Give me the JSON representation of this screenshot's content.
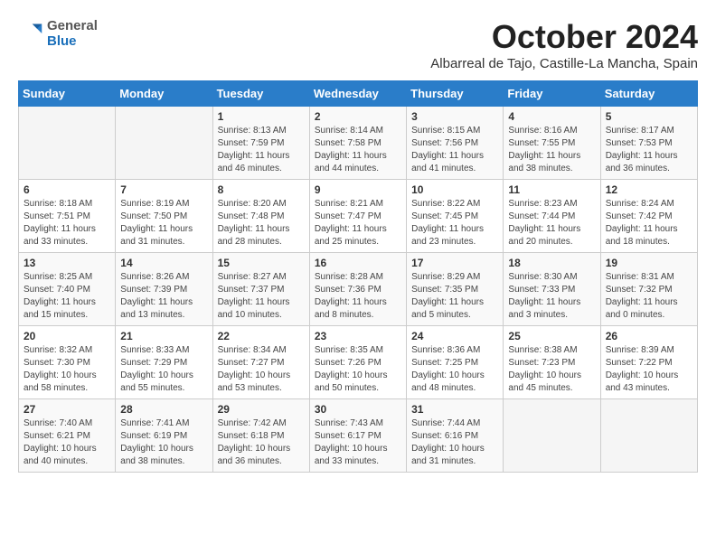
{
  "header": {
    "logo_general": "General",
    "logo_blue": "Blue",
    "month_title": "October 2024",
    "subtitle": "Albarreal de Tajo, Castille-La Mancha, Spain"
  },
  "weekdays": [
    "Sunday",
    "Monday",
    "Tuesday",
    "Wednesday",
    "Thursday",
    "Friday",
    "Saturday"
  ],
  "weeks": [
    [
      {
        "day": "",
        "info": ""
      },
      {
        "day": "",
        "info": ""
      },
      {
        "day": "1",
        "info": "Sunrise: 8:13 AM\nSunset: 7:59 PM\nDaylight: 11 hours and 46 minutes."
      },
      {
        "day": "2",
        "info": "Sunrise: 8:14 AM\nSunset: 7:58 PM\nDaylight: 11 hours and 44 minutes."
      },
      {
        "day": "3",
        "info": "Sunrise: 8:15 AM\nSunset: 7:56 PM\nDaylight: 11 hours and 41 minutes."
      },
      {
        "day": "4",
        "info": "Sunrise: 8:16 AM\nSunset: 7:55 PM\nDaylight: 11 hours and 38 minutes."
      },
      {
        "day": "5",
        "info": "Sunrise: 8:17 AM\nSunset: 7:53 PM\nDaylight: 11 hours and 36 minutes."
      }
    ],
    [
      {
        "day": "6",
        "info": "Sunrise: 8:18 AM\nSunset: 7:51 PM\nDaylight: 11 hours and 33 minutes."
      },
      {
        "day": "7",
        "info": "Sunrise: 8:19 AM\nSunset: 7:50 PM\nDaylight: 11 hours and 31 minutes."
      },
      {
        "day": "8",
        "info": "Sunrise: 8:20 AM\nSunset: 7:48 PM\nDaylight: 11 hours and 28 minutes."
      },
      {
        "day": "9",
        "info": "Sunrise: 8:21 AM\nSunset: 7:47 PM\nDaylight: 11 hours and 25 minutes."
      },
      {
        "day": "10",
        "info": "Sunrise: 8:22 AM\nSunset: 7:45 PM\nDaylight: 11 hours and 23 minutes."
      },
      {
        "day": "11",
        "info": "Sunrise: 8:23 AM\nSunset: 7:44 PM\nDaylight: 11 hours and 20 minutes."
      },
      {
        "day": "12",
        "info": "Sunrise: 8:24 AM\nSunset: 7:42 PM\nDaylight: 11 hours and 18 minutes."
      }
    ],
    [
      {
        "day": "13",
        "info": "Sunrise: 8:25 AM\nSunset: 7:40 PM\nDaylight: 11 hours and 15 minutes."
      },
      {
        "day": "14",
        "info": "Sunrise: 8:26 AM\nSunset: 7:39 PM\nDaylight: 11 hours and 13 minutes."
      },
      {
        "day": "15",
        "info": "Sunrise: 8:27 AM\nSunset: 7:37 PM\nDaylight: 11 hours and 10 minutes."
      },
      {
        "day": "16",
        "info": "Sunrise: 8:28 AM\nSunset: 7:36 PM\nDaylight: 11 hours and 8 minutes."
      },
      {
        "day": "17",
        "info": "Sunrise: 8:29 AM\nSunset: 7:35 PM\nDaylight: 11 hours and 5 minutes."
      },
      {
        "day": "18",
        "info": "Sunrise: 8:30 AM\nSunset: 7:33 PM\nDaylight: 11 hours and 3 minutes."
      },
      {
        "day": "19",
        "info": "Sunrise: 8:31 AM\nSunset: 7:32 PM\nDaylight: 11 hours and 0 minutes."
      }
    ],
    [
      {
        "day": "20",
        "info": "Sunrise: 8:32 AM\nSunset: 7:30 PM\nDaylight: 10 hours and 58 minutes."
      },
      {
        "day": "21",
        "info": "Sunrise: 8:33 AM\nSunset: 7:29 PM\nDaylight: 10 hours and 55 minutes."
      },
      {
        "day": "22",
        "info": "Sunrise: 8:34 AM\nSunset: 7:27 PM\nDaylight: 10 hours and 53 minutes."
      },
      {
        "day": "23",
        "info": "Sunrise: 8:35 AM\nSunset: 7:26 PM\nDaylight: 10 hours and 50 minutes."
      },
      {
        "day": "24",
        "info": "Sunrise: 8:36 AM\nSunset: 7:25 PM\nDaylight: 10 hours and 48 minutes."
      },
      {
        "day": "25",
        "info": "Sunrise: 8:38 AM\nSunset: 7:23 PM\nDaylight: 10 hours and 45 minutes."
      },
      {
        "day": "26",
        "info": "Sunrise: 8:39 AM\nSunset: 7:22 PM\nDaylight: 10 hours and 43 minutes."
      }
    ],
    [
      {
        "day": "27",
        "info": "Sunrise: 7:40 AM\nSunset: 6:21 PM\nDaylight: 10 hours and 40 minutes."
      },
      {
        "day": "28",
        "info": "Sunrise: 7:41 AM\nSunset: 6:19 PM\nDaylight: 10 hours and 38 minutes."
      },
      {
        "day": "29",
        "info": "Sunrise: 7:42 AM\nSunset: 6:18 PM\nDaylight: 10 hours and 36 minutes."
      },
      {
        "day": "30",
        "info": "Sunrise: 7:43 AM\nSunset: 6:17 PM\nDaylight: 10 hours and 33 minutes."
      },
      {
        "day": "31",
        "info": "Sunrise: 7:44 AM\nSunset: 6:16 PM\nDaylight: 10 hours and 31 minutes."
      },
      {
        "day": "",
        "info": ""
      },
      {
        "day": "",
        "info": ""
      }
    ]
  ]
}
